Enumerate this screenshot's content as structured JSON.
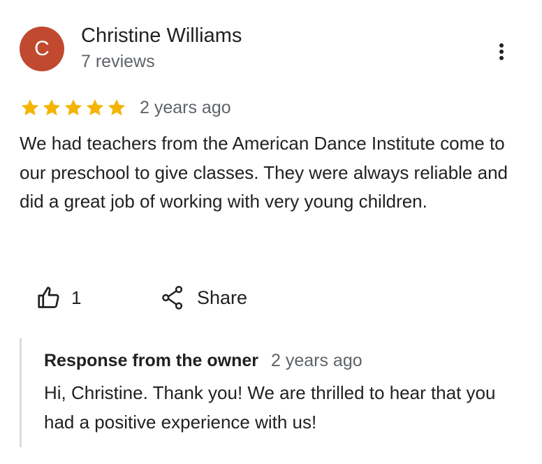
{
  "review": {
    "author": {
      "initial": "C",
      "name": "Christine Williams",
      "meta": "7 reviews",
      "avatar_color": "#c1492f"
    },
    "menu_icon": "more-vert-icon",
    "rating": 5,
    "rating_max": 5,
    "star_color": "#f4b400",
    "date": "2 years ago",
    "text": "We had teachers from the American Dance Institute come to our preschool to give classes. They were always reliable and did a great job of working with very young children.",
    "actions": {
      "like_icon": "thumbs-up-icon",
      "like_count": "1",
      "share_icon": "share-icon",
      "share_label": "Share"
    },
    "owner_response": {
      "title": "Response from the owner",
      "date": "2 years ago",
      "text": "Hi, Christine. Thank you! We are thrilled to hear that you had a positive experience with us!"
    }
  }
}
